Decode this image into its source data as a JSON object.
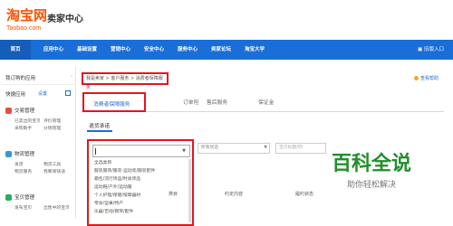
{
  "header": {
    "logo_text": "淘宝网",
    "logo_sub": "Taobao.com",
    "title": "卖家中心"
  },
  "nav": {
    "items": [
      "首页",
      "应用中心",
      "基础设置",
      "营销中心",
      "安全中心",
      "服务中心",
      "卖家论坛",
      "淘宝大学"
    ],
    "right_label": "旧版入口"
  },
  "sidebar": {
    "my_apps": "我订购的应用",
    "quick_apps": "快捷应用",
    "quick_apps_action": "设置",
    "sections": [
      {
        "title": "交易管理",
        "items": [
          "已卖出的宝贝",
          "评价管理",
          "采购助手",
          "分销管理"
        ]
      },
      {
        "title": "物流管理",
        "items": [
          "发货",
          "物流工具",
          "物流服务",
          "我要寄快递"
        ]
      },
      {
        "title": "宝贝管理",
        "items": [
          "发布宝贝",
          "出售中的宝贝"
        ]
      }
    ]
  },
  "breadcrumb": "我是卖家 > 客户服务 > 消费者保障服务",
  "help_link": "查看帮助",
  "tabs": {
    "active": "消费者保障服务",
    "others": [
      "订单险",
      "售后服务",
      "保证金"
    ]
  },
  "subtab": "退货承诺",
  "dropdown": {
    "value": "",
    "options": [
      "全选类目",
      "服装服饰/服装-运动装/服装配件",
      "箱包/流行饰品/时尚饰品",
      "运动鞋/户外/运动服",
      "个人护理/保健/按摩器材",
      "零食/坚果/特产",
      "乐器/吉他/钢琴/配件"
    ]
  },
  "filters": {
    "status_placeholder": "所有状态",
    "search_placeholder": "宝贝标题/ID"
  },
  "table": {
    "columns": [
      "类目",
      "约定内容",
      "履约状态"
    ]
  },
  "watermark": {
    "main": "百科全说",
    "sub": "助你轻松解决"
  },
  "colors": {
    "brand_orange": "#ff5000",
    "nav_blue": "#1a6ed8",
    "highlight_red": "#e0171f",
    "watermark_green": "#1f8f2a"
  }
}
